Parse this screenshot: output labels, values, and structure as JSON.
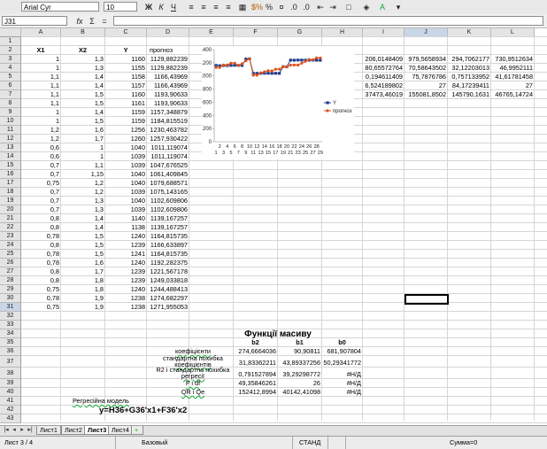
{
  "toolbar": {
    "font_name": "Arial Cyr",
    "font_size": "10",
    "bold": "Ж",
    "italic": "К",
    "underline": "Ч",
    "percent": "%",
    "currency": "$%"
  },
  "formula": {
    "cell_ref": "J31",
    "fx": "fx",
    "sigma": "Σ",
    "equals": "="
  },
  "columns": [
    "A",
    "B",
    "C",
    "D",
    "E",
    "F",
    "G",
    "H",
    "I",
    "J",
    "K",
    "L"
  ],
  "rows": [
    "1",
    "2",
    "3",
    "4",
    "5",
    "6",
    "7",
    "8",
    "9",
    "10",
    "11",
    "12",
    "13",
    "14",
    "15",
    "16",
    "17",
    "18",
    "19",
    "20",
    "21",
    "22",
    "23",
    "24",
    "25",
    "26",
    "27",
    "28",
    "29",
    "30",
    "31",
    "32",
    "33",
    "34",
    "35",
    "36",
    "37",
    "38",
    "39",
    "40",
    "41",
    "42",
    "43"
  ],
  "headers": {
    "x1": "X1",
    "x2": "X2",
    "y": "Y",
    "forecast": "прогноз"
  },
  "table": [
    [
      "1",
      "1,3",
      "1160",
      "1129,882239"
    ],
    [
      "1",
      "1,3",
      "1155",
      "1129,882239"
    ],
    [
      "1,1",
      "1,4",
      "1158",
      "1166,43969"
    ],
    [
      "1,1",
      "1,4",
      "1157",
      "1166,43969"
    ],
    [
      "1,1",
      "1,5",
      "1160",
      "1193,90633"
    ],
    [
      "1,1",
      "1,5",
      "1161",
      "1193,90633"
    ],
    [
      "1",
      "1,4",
      "1159",
      "1157,348879"
    ],
    [
      "1",
      "1,5",
      "1159",
      "1184,815519"
    ],
    [
      "1,2",
      "1,6",
      "1256",
      "1230,463782"
    ],
    [
      "1,2",
      "1,7",
      "1260",
      "1257,930422"
    ],
    [
      "0,6",
      "1",
      "1040",
      "1011,119074"
    ],
    [
      "0,6",
      "1",
      "1039",
      "1011,119074"
    ],
    [
      "0,7",
      "1,1",
      "1039",
      "1047,676525"
    ],
    [
      "0,7",
      "1,15",
      "1040",
      "1061,409845"
    ],
    [
      "0,75",
      "1,2",
      "1040",
      "1079,688571"
    ],
    [
      "0,7",
      "1,2",
      "1039",
      "1075,143165"
    ],
    [
      "0,7",
      "1,3",
      "1040",
      "1102,609806"
    ],
    [
      "0,7",
      "1,3",
      "1039",
      "1102,609806"
    ],
    [
      "0,8",
      "1,4",
      "1140",
      "1139,167257"
    ],
    [
      "0,8",
      "1,4",
      "1138",
      "1139,167257"
    ],
    [
      "0,78",
      "1,5",
      "1240",
      "1164,815735"
    ],
    [
      "0,8",
      "1,5",
      "1239",
      "1166,633897"
    ],
    [
      "0,78",
      "1,5",
      "1241",
      "1164,815735"
    ],
    [
      "0,78",
      "1,6",
      "1240",
      "1192,282375"
    ],
    [
      "0,8",
      "1,7",
      "1239",
      "1221,567178"
    ],
    [
      "0,8",
      "1,8",
      "1239",
      "1249,033818"
    ],
    [
      "0,75",
      "1,8",
      "1240",
      "1244,488413"
    ],
    [
      "0,78",
      "1,9",
      "1238",
      "1274,682297"
    ],
    [
      "0,75",
      "1,9",
      "1238",
      "1271,955053"
    ]
  ],
  "right_block": [
    [
      "206,0148409",
      "979,5658934",
      "294,7062177",
      "730,9512634"
    ],
    [
      "80,65572764",
      "70,58643502",
      "32,12203013",
      "46,9952111"
    ],
    [
      "0,194611409",
      "75,7876786",
      "0,757133952",
      "41,61781458"
    ],
    [
      "6,524189802",
      "27",
      "84,17239411",
      "27"
    ],
    [
      "37473,46019",
      "155081,8502",
      "145790,1631",
      "46765,14724"
    ]
  ],
  "func": {
    "title": "Функції масиву",
    "col_b2": "b2",
    "col_b1": "b1",
    "col_b0": "b0",
    "rows": [
      {
        "label": "коефіцієнти",
        "v": [
          "274,6664036",
          "90,90811",
          "681,907804"
        ]
      },
      {
        "label1": "стандартна похибка",
        "label2": "коефіцієнтів",
        "v": [
          "31,83362211",
          "43,89337256",
          "50,29341772"
        ]
      },
      {
        "label1": "R2  і  стандартна похибка",
        "label2": "регресії",
        "v": [
          "0,791527894",
          "39,29298772",
          "#Н/Д"
        ]
      },
      {
        "label": "F     і df",
        "v": [
          "49,35846261",
          "26",
          "#Н/Д"
        ]
      },
      {
        "label": "QR і Qe",
        "v": [
          "152412,8994",
          "40142,41098",
          "#Н/Д"
        ]
      }
    ],
    "model_label": "Регресійна модель",
    "model_formula": "y=H36+G36'x1+F36'x2"
  },
  "sheets": [
    "Лист1",
    "Лист2",
    "Лист3",
    "Лист4"
  ],
  "status": {
    "sheet": "Лист 3 / 4",
    "style": "Базовый",
    "mode": "СТАНД",
    "sum": "Сумма=0"
  },
  "chart_data": {
    "type": "line",
    "categories": [
      "1",
      "2",
      "3",
      "4",
      "5",
      "6",
      "7",
      "8",
      "9",
      "10",
      "11",
      "12",
      "13",
      "14",
      "15",
      "16",
      "17",
      "18",
      "19",
      "20",
      "21",
      "22",
      "23",
      "24",
      "25",
      "26",
      "27",
      "28",
      "29"
    ],
    "x_tick_labels_row1": [
      "2",
      "4",
      "6",
      "8",
      "10",
      "12",
      "14",
      "16",
      "18",
      "20",
      "22",
      "24",
      "26",
      "28"
    ],
    "x_tick_labels_row2": [
      "1",
      "3",
      "5",
      "7",
      "9",
      "11",
      "13",
      "15",
      "17",
      "19",
      "21",
      "23",
      "25",
      "27",
      "29"
    ],
    "ylim": [
      0,
      1400
    ],
    "yticks": [
      "0",
      "200",
      "400",
      "600",
      "800",
      "1000",
      "1200",
      "1400"
    ],
    "series": [
      {
        "name": "Y",
        "color": "#1f3f8f",
        "values": [
          1160,
          1155,
          1158,
          1157,
          1160,
          1161,
          1159,
          1159,
          1256,
          1260,
          1040,
          1039,
          1039,
          1040,
          1040,
          1039,
          1040,
          1039,
          1140,
          1138,
          1240,
          1239,
          1241,
          1240,
          1239,
          1239,
          1240,
          1238,
          1238
        ]
      },
      {
        "name": "прогноз",
        "color": "#e0501a",
        "values": [
          1129.88,
          1129.88,
          1166.44,
          1166.44,
          1193.91,
          1193.91,
          1157.35,
          1184.82,
          1230.46,
          1257.93,
          1011.12,
          1011.12,
          1047.68,
          1061.41,
          1079.69,
          1075.14,
          1102.61,
          1102.61,
          1139.17,
          1139.17,
          1164.82,
          1166.63,
          1164.82,
          1192.28,
          1221.57,
          1249.03,
          1244.49,
          1274.68,
          1271.96
        ]
      }
    ],
    "legend_position": "right"
  }
}
